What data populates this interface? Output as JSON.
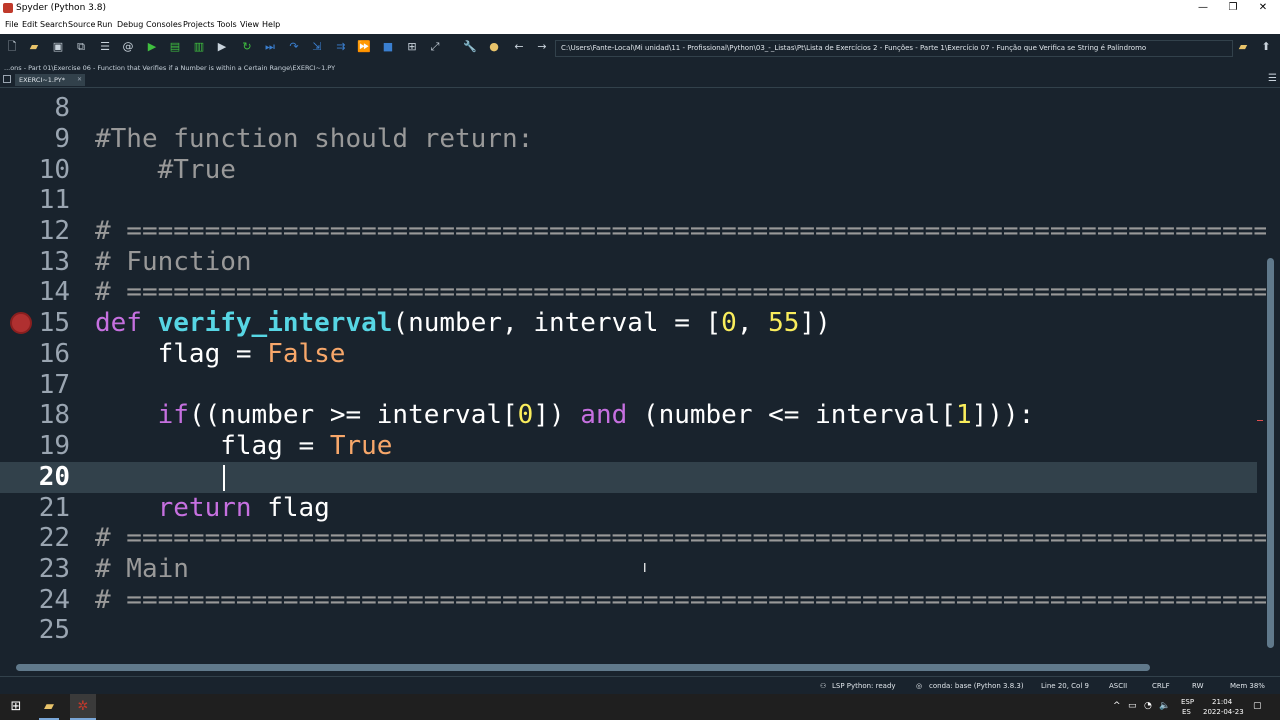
{
  "window": {
    "title": "Spyder (Python 3.8)",
    "minimize": "—",
    "maximize": "❐",
    "close": "✕"
  },
  "menu": [
    "File",
    "Edit",
    "Search",
    "Source",
    "Run",
    "Debug",
    "Consoles",
    "Projects",
    "Tools",
    "View",
    "Help"
  ],
  "toolbar": {
    "path": "C:\\Users\\Fante-Local\\Mi unidad\\11 - Profissional\\Python\\03_-_Listas\\Pt\\Lista de Exercícios 2 - Funções - Parte 1\\Exercício 07 - Função que Verifica se String é Palíndromo"
  },
  "file_path_label": "...ons - Part 01\\Exercise 06 - Function that Verifies if a Number is within a Certain Range\\EXERCI~1.PY",
  "tab": {
    "label": "EXERCI~1.PY*"
  },
  "editor": {
    "current_line": 20,
    "lines": [
      {
        "n": "8",
        "text": ""
      },
      {
        "n": "9",
        "text": "#The function should return:"
      },
      {
        "n": "10",
        "text": "    #True"
      },
      {
        "n": "11",
        "text": ""
      },
      {
        "n": "12",
        "text": "# ======================================================================================"
      },
      {
        "n": "13",
        "text": "# Function"
      },
      {
        "n": "14",
        "text": "# ======================================================================================"
      },
      {
        "n": "15",
        "text": "def verify_interval(number, interval = [0, 55])"
      },
      {
        "n": "16",
        "text": "    flag = False"
      },
      {
        "n": "17",
        "text": ""
      },
      {
        "n": "18",
        "text": "    if((number >= interval[0]) and (number <= interval[1])):"
      },
      {
        "n": "19",
        "text": "        flag = True"
      },
      {
        "n": "20",
        "text": ""
      },
      {
        "n": "21",
        "text": "    return flag"
      },
      {
        "n": "22",
        "text": "# ======================================================================================"
      },
      {
        "n": "23",
        "text": "# Main"
      },
      {
        "n": "24",
        "text": "# ======================================================================================"
      },
      {
        "n": "25",
        "text": ""
      }
    ]
  },
  "status": {
    "lsp": "LSP Python: ready",
    "conda": "conda: base (Python 3.8.3)",
    "position": "Line 20, Col 9",
    "encoding": "ASCII",
    "eol": "CRLF",
    "rw": "RW",
    "mem": "Mem 38%"
  },
  "taskbar": {
    "lang_top": "ESP",
    "lang_bottom": "ES",
    "time": "21:04",
    "date": "2022-04-23"
  },
  "colors": {
    "background": "#19232d",
    "current_line": "#32414b",
    "keyword": "#c670e0",
    "function": "#57d6e4",
    "number": "#faed5c",
    "boolean": "#f7a76a",
    "comment": "#999999"
  }
}
